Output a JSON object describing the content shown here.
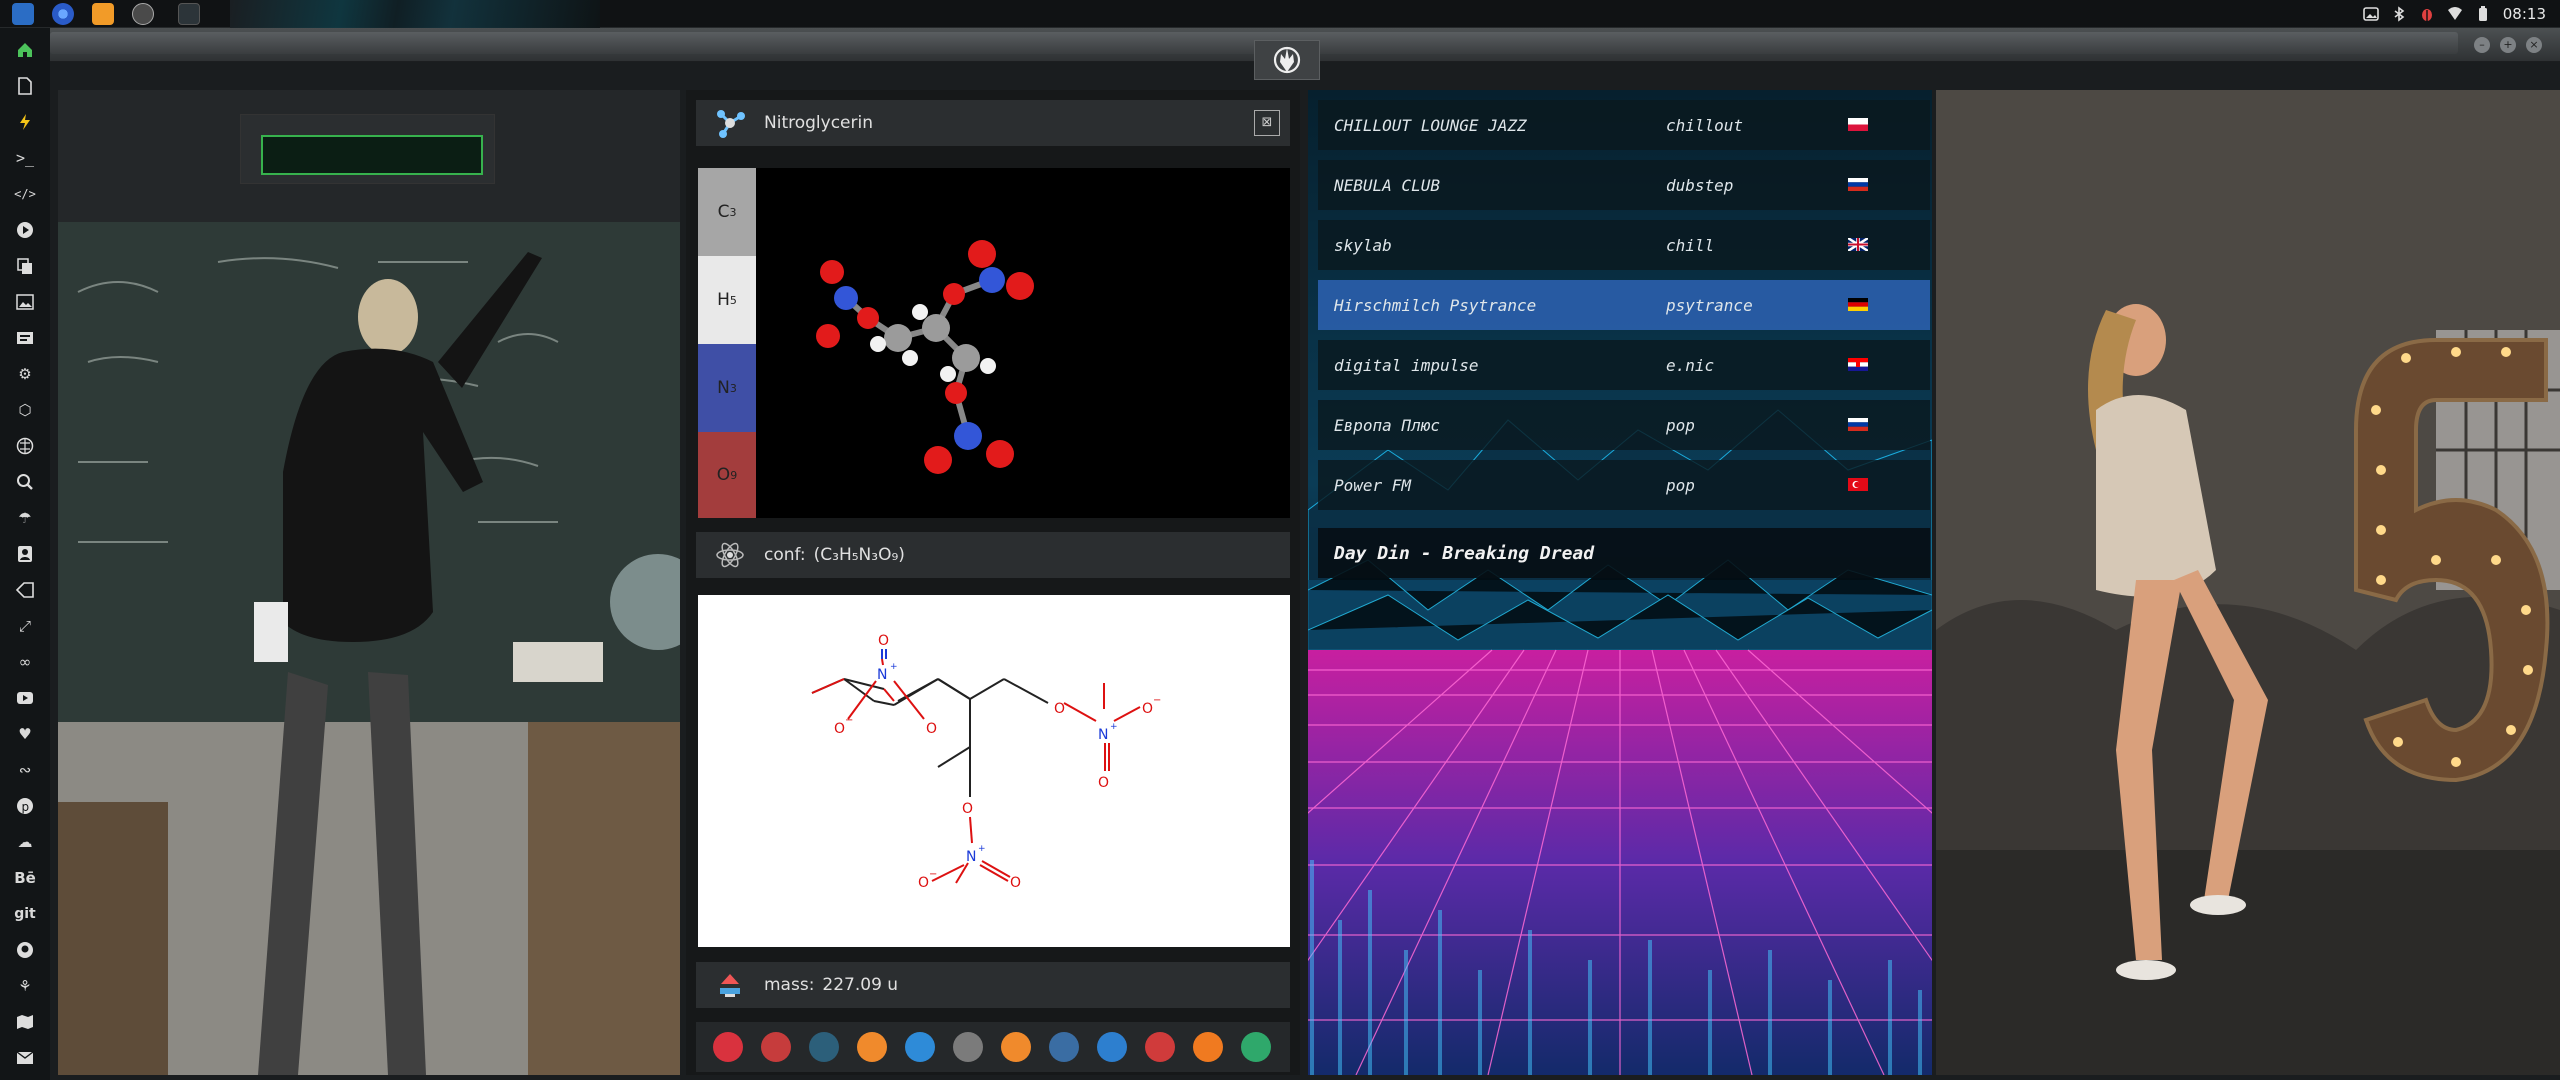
{
  "topbar": {
    "clock": "08:13",
    "tray_icons": [
      "image-icon",
      "bluetooth-icon",
      "bug-icon",
      "wifi-icon",
      "battery-icon"
    ]
  },
  "dock": {
    "icons": [
      "home-icon",
      "document-icon",
      "bolt-icon",
      "terminal-icon",
      "code-icon",
      "play-icon",
      "copy-icon",
      "image-icon",
      "slides-icon",
      "settings-icon",
      "hexagon-icon",
      "globe-icon",
      "search-icon",
      "umbrella-icon",
      "contacts-icon",
      "tag-icon",
      "expand-icon",
      "infinity-icon",
      "youtube-icon",
      "heart-icon",
      "lastfm-icon",
      "pinterest-icon",
      "cloud-icon",
      "behance-icon",
      "git-icon",
      "github-icon",
      "puzzle-icon",
      "map-icon",
      "mail-icon",
      "envelope-icon"
    ],
    "behance_text": "Bē",
    "git_text": "git"
  },
  "panel1": {
    "input_value": ""
  },
  "molecule": {
    "name": "Nitroglycerin",
    "elements": [
      {
        "symbol": "C",
        "count": "3",
        "color": "#a6a6a6"
      },
      {
        "symbol": "H",
        "count": "5",
        "color": "#e9e9e9"
      },
      {
        "symbol": "N",
        "count": "3",
        "color": "#3f4fa6"
      },
      {
        "symbol": "O",
        "count": "9",
        "color": "#a33d3d"
      }
    ],
    "conf_label": "conf:",
    "conf_value": "(C₃H₅N₃O₉)",
    "mass_label": "mass:",
    "mass_value": "227.09 u",
    "close_glyph": "⊠"
  },
  "taskbar": {
    "apps": [
      {
        "name": "app-launcher-icon",
        "color": "#d9323e"
      },
      {
        "name": "timer-icon",
        "color": "#c63c3c"
      },
      {
        "name": "galaxy-icon",
        "color": "#2c5f7a"
      },
      {
        "name": "photos-icon",
        "color": "#f08a2c"
      },
      {
        "name": "translate-icon",
        "color": "#2e8bd8"
      },
      {
        "name": "notes-icon",
        "color": "#7b7b7b"
      },
      {
        "name": "search-app-icon",
        "color": "#f08a2c"
      },
      {
        "name": "clock-app-icon",
        "color": "#3a6da3"
      },
      {
        "name": "browser-icon",
        "color": "#2d7fcf"
      },
      {
        "name": "calendar-icon",
        "color": "#d03b3b"
      },
      {
        "name": "forward-icon",
        "color": "#f07a20"
      },
      {
        "name": "yandex-icon",
        "color": "#2fa86b"
      }
    ]
  },
  "radio": {
    "stations": [
      {
        "name": "CHILLOUT LOUNGE JAZZ",
        "genre": "chillout",
        "flag": "poland"
      },
      {
        "name": "NEBULA CLUB",
        "genre": "dubstep",
        "flag": "russia"
      },
      {
        "name": "skylab",
        "genre": "chill",
        "flag": "uk"
      },
      {
        "name": "Hirschmilch Psytrance",
        "genre": "psytrance",
        "flag": "germany",
        "selected": true
      },
      {
        "name": "digital impulse",
        "genre": "e.nic",
        "flag": "croatia"
      },
      {
        "name": "Европа Плюс",
        "genre": "pop",
        "flag": "russia"
      },
      {
        "name": "Power FM",
        "genre": "pop",
        "flag": "turkey"
      }
    ],
    "now_playing": "Day Din - Breaking Dread"
  },
  "colors": {
    "accent_green": "#37b24d",
    "selection_blue": "#2a5eaa",
    "background": "#1a1d1f"
  }
}
